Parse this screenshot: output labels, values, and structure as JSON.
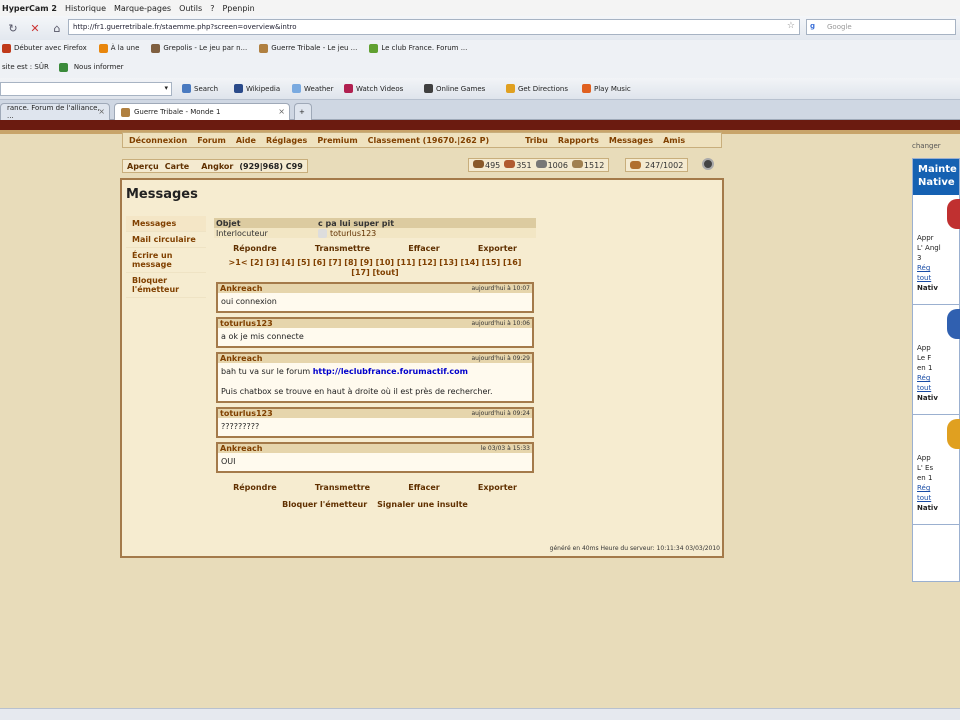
{
  "browser": {
    "app_title": "HyperCam 2",
    "menu": [
      "Historique",
      "Marque-pages",
      "Outils",
      "?",
      "Ppenpin"
    ],
    "url": "http://fr1.guerretribale.fr/staemme.php?screen=overview&intro",
    "search_placeholder": "Google",
    "bookmarks": [
      "Débuter avec Firefox",
      "À la une",
      "Grepolis - Le jeu par n...",
      "Guerre Tribale - Le jeu ...",
      "Le club France. Forum ..."
    ],
    "row3": [
      "site est : SÛR",
      "Nous informer"
    ],
    "toolbar": [
      "Search",
      "Wikipedia",
      "Weather",
      "Watch Videos",
      "Online Games",
      "Get Directions",
      "Play Music"
    ],
    "tabs": [
      "rance. Forum de l'alliance, ...",
      "Guerre Tribale - Monde 1"
    ]
  },
  "game": {
    "nav": [
      "Déconnexion",
      "Forum",
      "Aide",
      "Réglages",
      "Premium",
      "Classement (19670.|262 P)",
      "Tribu",
      "Rapports",
      "Messages",
      "Amis"
    ],
    "village": {
      "apercu": "Aperçu",
      "carte": "Carte",
      "name": "Angkor",
      "coords": "(929|968) C99"
    },
    "resources": [
      "495",
      "351",
      "1006",
      "1512"
    ],
    "population": "247/1002",
    "title": "Messages",
    "left_menu": [
      "Messages",
      "Mail circulaire",
      "Écrire un message",
      "Bloquer l'émetteur"
    ],
    "subject_label": "Objet",
    "subject_value": "c pa lui super pit",
    "partner_label": "Interlocuteur",
    "partner_value": "toturlus123",
    "actions": [
      "Répondre",
      "Transmettre",
      "Effacer",
      "Exporter"
    ],
    "pages": ">1< [2] [3] [4] [5] [6] [7] [8] [9] [10] [11] [12] [13] [14] [15] [16] [17] [tout]",
    "messages": [
      {
        "author": "Ankreach",
        "date": "aujourd'hui à 10:07",
        "text": "oui connexion",
        "link": "",
        "text2": ""
      },
      {
        "author": "toturlus123",
        "date": "aujourd'hui à 10:06",
        "text": "a ok je mis connecte",
        "link": "",
        "text2": ""
      },
      {
        "author": "Ankreach",
        "date": "aujourd'hui à 09:29",
        "text": "bah tu va sur le forum",
        "link": "http://leclubfrance.forumactif.com",
        "text2": "Puis chatbox se trouve en haut à droite où il est près de rechercher."
      },
      {
        "author": "toturlus123",
        "date": "aujourd'hui à 09:24",
        "text": "?????????",
        "link": "",
        "text2": ""
      },
      {
        "author": "Ankreach",
        "date": "le 03/03 à 15:33",
        "text": "OUI",
        "link": "",
        "text2": ""
      }
    ],
    "bottom_actions": [
      "Répondre",
      "Transmettre",
      "Effacer",
      "Exporter"
    ],
    "bottom2": [
      "Bloquer l'émetteur",
      "Signaler une insulte"
    ],
    "footer": "généré en 40ms Heure du serveur: 10:11:34 03/03/2010"
  },
  "ad": {
    "top": "changer",
    "header": "Mainte Native",
    "boxes": [
      {
        "line1": "Appr",
        "line2": "L' Angl",
        "line3": "3",
        "link": "Rég",
        "link2": "tout",
        "foot": "Nativ"
      },
      {
        "line1": "App",
        "line2": "Le F",
        "line3": "en 1",
        "link": "Rég",
        "link2": "tout",
        "foot": "Nativ"
      },
      {
        "line1": "App",
        "line2": "L' Es",
        "line3": "en 1",
        "link": "Rég",
        "link2": "tout",
        "foot": "Nativ"
      }
    ],
    "flags": [
      "#c03030",
      "#3060b0",
      "#e0a020"
    ]
  }
}
